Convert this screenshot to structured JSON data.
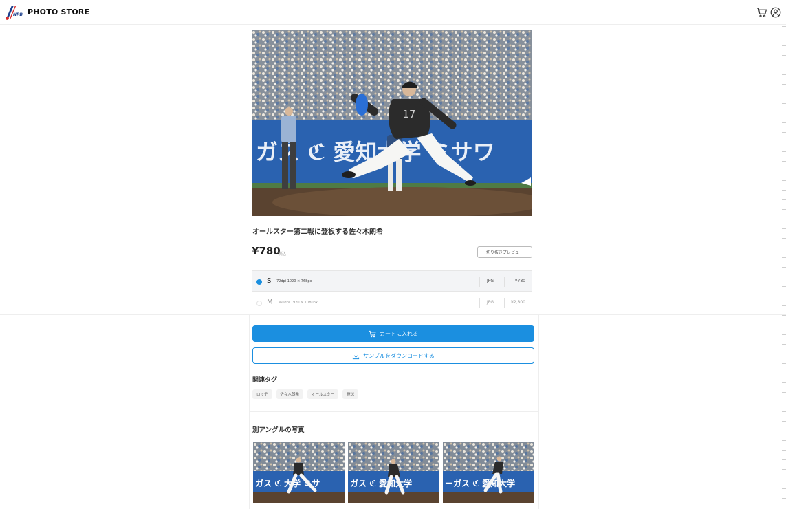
{
  "header": {
    "brand": "PHOTO STORE",
    "cart_icon": "cart-icon",
    "account_icon": "user-circle-icon"
  },
  "photo": {
    "title": "オールスター第二戦に登板する佐々木朗希",
    "price": "¥780",
    "tax_label": "税込",
    "preview_button": "切り抜きプレビュー",
    "player_number": "17",
    "banner_text": "ガス  ℭ 愛知大学  ミサワ"
  },
  "sizes": [
    {
      "letter": "S",
      "spec": "72dpi 1020 × 768px",
      "format": "JPG",
      "price": "¥780",
      "selected": true
    },
    {
      "letter": "M",
      "spec": "360dpi 1920 × 1080px",
      "format": "JPG",
      "price": "¥2,800",
      "selected": false
    }
  ],
  "actions": {
    "add_to_cart": "カートに入れる",
    "download_sample": "サンプルをダウンロードする"
  },
  "tags": {
    "heading": "関連タグ",
    "items": [
      "ロッテ",
      "佐々木朗希",
      "オールスター",
      "投球"
    ]
  },
  "angles": {
    "heading": "別アングルの写真",
    "thumbs": [
      {
        "banner": "ガス ℭ 大学 ミサ"
      },
      {
        "banner": "ガス ℭ 愛知大学"
      },
      {
        "banner": "ーガス ℭ 愛知大学"
      }
    ]
  },
  "colors": {
    "accent": "#1b8fe0",
    "uniform": "#2b2b2b",
    "banner": "#2a62b0"
  }
}
